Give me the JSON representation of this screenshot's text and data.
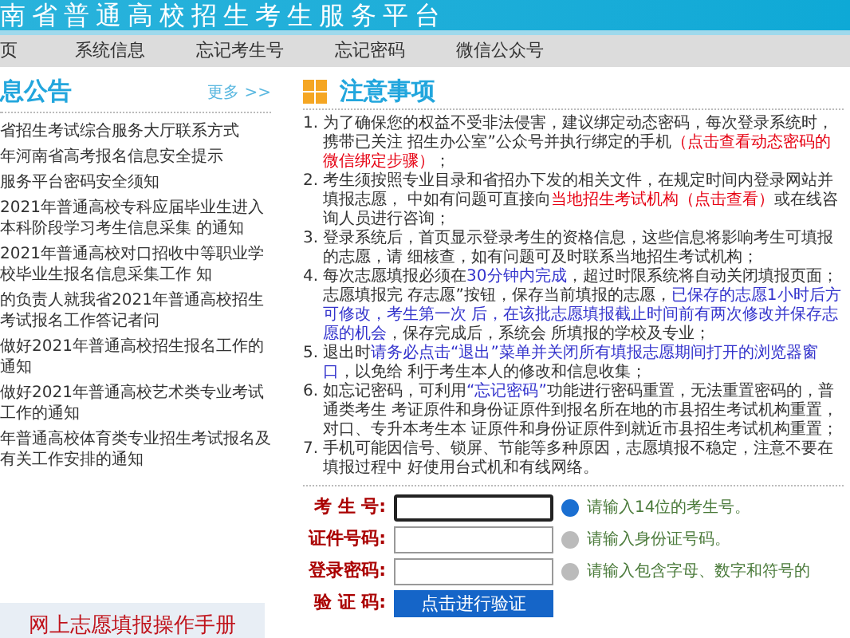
{
  "header": {
    "title": "南省普通高校招生考生服务平台"
  },
  "nav": [
    {
      "label": "页"
    },
    {
      "label": "系统信息"
    },
    {
      "label": "忘记考生号"
    },
    {
      "label": "忘记密码"
    },
    {
      "label": "微信公众号"
    }
  ],
  "news": {
    "title": "息公告",
    "more": "更多 >>",
    "items": [
      "省招生考试综合服务大厅联系方式",
      "年河南省高考报名信息安全提示",
      "服务平台密码安全须知",
      "2021年普通高校专科应届毕业生进入本科阶段学习考生信息采集 的通知",
      "2021年普通高校对口招收中等职业学校毕业生报名信息采集工作 知",
      "的负责人就我省2021年普通高校招生考试报名工作答记者问",
      "做好2021年普通高校招生报名工作的通知",
      "做好2021年普通高校艺术类专业考试工作的通知",
      "年普通高校体育类专业招生考试报名及有关工作安排的通知"
    ],
    "manual": "网上志愿填报操作手册"
  },
  "notes": {
    "title": "注意事项",
    "items": [
      {
        "number": "1.",
        "segments": [
          {
            "kind": "plain",
            "text": "为了确保您的权益不受非法侵害，建议绑定动态密码，每次登录系统时，携带已关注 招生办公室”公众号并执行绑定的手机"
          },
          {
            "kind": "red",
            "text": "（点击查看动态密码的微信绑定步骤）"
          },
          {
            "kind": "plain",
            "text": "；"
          }
        ]
      },
      {
        "number": "2.",
        "segments": [
          {
            "kind": "plain",
            "text": "考生须按照专业目录和省招办下发的相关文件，在规定时间内登录网站并填报志愿， 中如有问题可直接向"
          },
          {
            "kind": "red",
            "text": "当地招生考试机构（点击查看）"
          },
          {
            "kind": "plain",
            "text": "或在线咨询人员进行咨询；"
          }
        ]
      },
      {
        "number": "3.",
        "segments": [
          {
            "kind": "plain",
            "text": "登录系统后，首页显示登录考生的资格信息，这些信息将影响考生可填报的志愿，请 细核查，如有问题可及时联系当地招生考试机构；"
          }
        ]
      },
      {
        "number": "4.",
        "segments": [
          {
            "kind": "plain",
            "text": "每次志愿填报必须在"
          },
          {
            "kind": "blue",
            "text": "30分钟内完成"
          },
          {
            "kind": "plain",
            "text": "，超过时限系统将自动关闭填报页面；志愿填报完 存志愿”按钮，保存当前填报的志愿，"
          },
          {
            "kind": "blue",
            "text": "已保存的志愿1小时后方可修改，考生第一次 后，在该批志愿填报截止时间前有两次修改并保存志愿的机会"
          },
          {
            "kind": "plain",
            "text": "，保存完成后，系统会 所填报的学校及专业；"
          }
        ]
      },
      {
        "number": "5.",
        "segments": [
          {
            "kind": "plain",
            "text": "退出时"
          },
          {
            "kind": "blue",
            "text": "请务必点击“退出”菜单并关闭所有填报志愿期间打开的浏览器窗口"
          },
          {
            "kind": "plain",
            "text": "，以免给 利于考生本人的修改和信息收集；"
          }
        ]
      },
      {
        "number": "6.",
        "segments": [
          {
            "kind": "plain",
            "text": "如忘记密码，可利用"
          },
          {
            "kind": "blue",
            "text": "“忘记密码”"
          },
          {
            "kind": "plain",
            "text": "功能进行密码重置，无法重置密码的，普通类考生 考证原件和身份证原件到报名所在地的市县招生考试机构重置，对口、专升本考生本 证原件和身份证原件到就近市县招生考试机构重置；"
          }
        ]
      },
      {
        "number": "7.",
        "segments": [
          {
            "kind": "plain",
            "text": "手机可能因信号、锁屏、节能等多种原因，志愿填报不稳定，注意不要在填报过程中 好使用台式机和有线网络。"
          }
        ]
      }
    ]
  },
  "form": [
    {
      "kind": "input",
      "label": "考 生 号:",
      "focused": true,
      "hint": "请输入14位的考生号。"
    },
    {
      "kind": "input",
      "label": "证件号码:",
      "focused": false,
      "hint": "请输入身份证号码。"
    },
    {
      "kind": "input",
      "label": "登录密码:",
      "focused": false,
      "hint": "请输入包含字母、数字和符号的"
    },
    {
      "kind": "captcha",
      "label": "验 证 码:",
      "button": "点击进行验证"
    }
  ]
}
